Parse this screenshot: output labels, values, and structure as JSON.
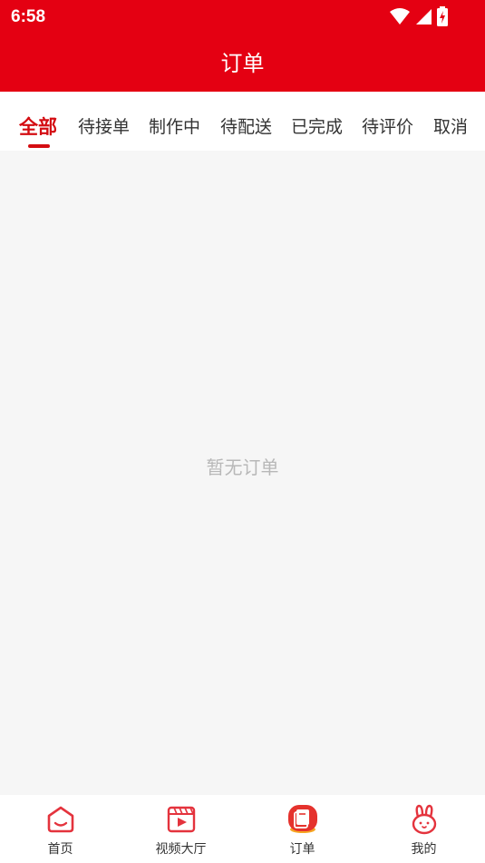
{
  "status_bar": {
    "time": "6:58"
  },
  "header": {
    "title": "订单"
  },
  "tabs": [
    {
      "label": "全部",
      "active": true
    },
    {
      "label": "待接单"
    },
    {
      "label": "制作中"
    },
    {
      "label": "待配送"
    },
    {
      "label": "已完成"
    },
    {
      "label": "待评价"
    },
    {
      "label": "取消"
    }
  ],
  "content": {
    "empty_text": "暂无订单"
  },
  "bottom_nav": [
    {
      "label": "首页",
      "icon": "home-icon"
    },
    {
      "label": "视频大厅",
      "icon": "video-icon"
    },
    {
      "label": "订单",
      "icon": "order-icon",
      "active": true
    },
    {
      "label": "我的",
      "icon": "rabbit-icon"
    }
  ],
  "colors": {
    "primary": "#e40012",
    "accent": "#d40d12",
    "background": "#f6f6f6"
  }
}
